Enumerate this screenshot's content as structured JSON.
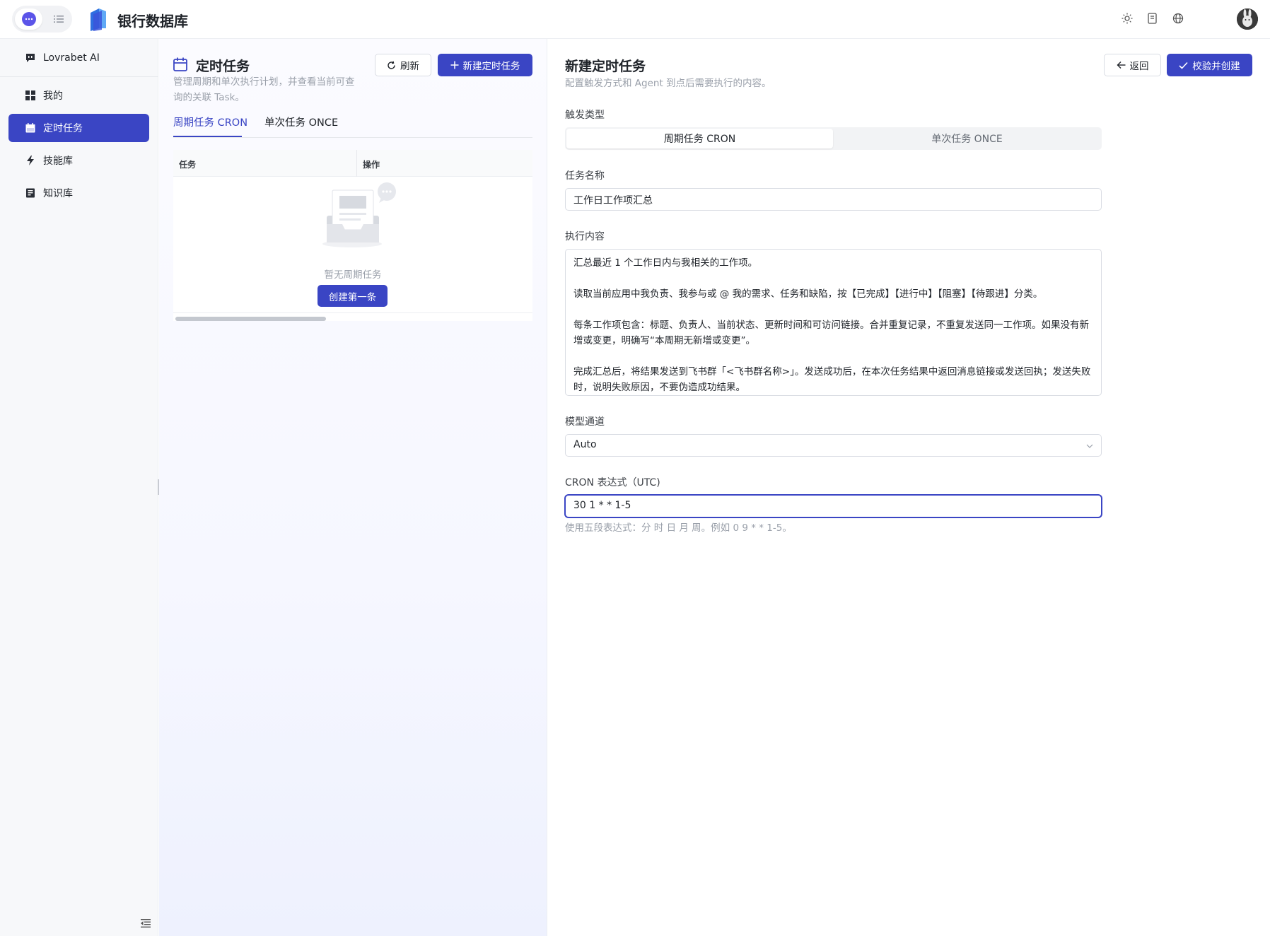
{
  "app": {
    "title": "银行数据库"
  },
  "sidebar": {
    "items": [
      {
        "label": "Lovrabet AI",
        "icon": "chat-bubble-icon"
      },
      {
        "label": "我的",
        "icon": "grid-icon"
      },
      {
        "label": "定时任务",
        "icon": "calendar-icon"
      },
      {
        "label": "技能库",
        "icon": "bolt-icon"
      },
      {
        "label": "知识库",
        "icon": "book-icon"
      }
    ]
  },
  "list": {
    "title": "定时任务",
    "desc": "管理周期和单次执行计划，并查看当前可查询的关联 Task。",
    "refresh_label": "刷新",
    "new_label": "新建定时任务",
    "tabs": [
      "周期任务 CRON",
      "单次任务 ONCE"
    ],
    "columns": [
      "任务",
      "操作"
    ],
    "empty_text": "暂无周期任务",
    "create_first_label": "创建第一条"
  },
  "form": {
    "title": "新建定时任务",
    "subtitle": "配置触发方式和 Agent 到点后需要执行的内容。",
    "back_label": "返回",
    "submit_label": "校验并创建",
    "trigger_label": "触发类型",
    "trigger_options": [
      "周期任务 CRON",
      "单次任务 ONCE"
    ],
    "name_label": "任务名称",
    "name_value": "工作日工作项汇总",
    "content_label": "执行内容",
    "content_paragraphs": [
      "汇总最近 1 个工作日内与我相关的工作项。",
      "读取当前应用中我负责、我参与或 @ 我的需求、任务和缺陷，按【已完成】【进行中】【阻塞】【待跟进】分类。",
      "每条工作项包含：标题、负责人、当前状态、更新时间和可访问链接。合并重复记录，不重复发送同一工作项。如果没有新增或变更，明确写“本周期无新增或变更”。",
      "完成汇总后，将结果发送到飞书群「<飞书群名称>」。发送成功后，在本次任务结果中返回消息链接或发送回执；发送失败时，说明失败原因，不要伪造成功结果。"
    ],
    "model_label": "模型通道",
    "model_value": "Auto",
    "cron_label": "CRON 表达式（UTC)",
    "cron_value": "30 1 * * 1-5",
    "cron_hint": "使用五段表达式：分 时 日 月 周。例如 0 9 * * 1-5。"
  }
}
